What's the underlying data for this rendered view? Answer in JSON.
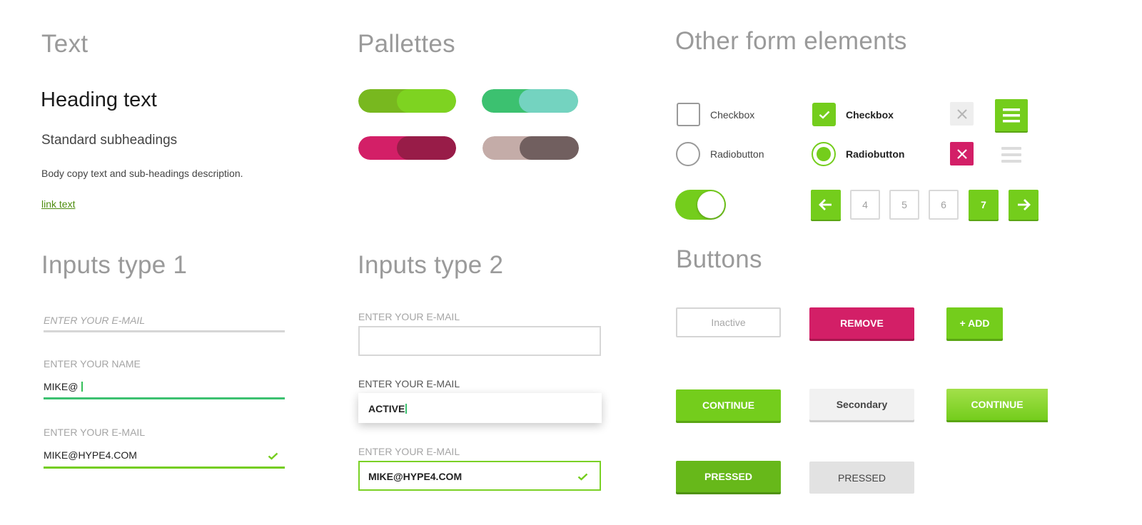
{
  "colors": {
    "green": "#74cd1c",
    "green_light": "#7ed321",
    "green_dark": "#6db81f",
    "teal": "#3cc170",
    "teal_light": "#74d3c0",
    "magenta": "#d31f67",
    "plum": "#981c48",
    "taupe": "#c4aca8",
    "taupe_dark": "#715f5f",
    "title_grey": "#9a9a9a"
  },
  "text_section": {
    "title": "Text",
    "heading": "Heading text",
    "subheading": "Standard subheadings",
    "body": "Body copy text and sub-headings description.",
    "link": "link text"
  },
  "palettes": {
    "title": "Pallettes",
    "swatches": [
      {
        "name": "green",
        "left": "#78b81f",
        "right": "#7ed321"
      },
      {
        "name": "teal",
        "left": "#3cc170",
        "right": "#74d3c0"
      },
      {
        "name": "magenta",
        "left": "#d31f67",
        "right": "#981c48"
      },
      {
        "name": "taupe",
        "left": "#c4aca8",
        "right": "#715f5f"
      }
    ]
  },
  "other_form": {
    "title": "Other form elements",
    "checkbox_label": "Checkbox",
    "checkbox_checked_label": "Checkbox",
    "radio_label": "Radiobutton",
    "radio_checked_label": "Radiobutton",
    "toggle_on": true,
    "pagination": {
      "pages": [
        "4",
        "5",
        "6",
        "7"
      ],
      "current": "7"
    }
  },
  "inputs1": {
    "title": "Inputs type 1",
    "field1": {
      "placeholder": "ENTER YOUR E-MAIL"
    },
    "field2": {
      "label": "ENTER YOUR NAME",
      "value": "MIKE@"
    },
    "field3": {
      "label": "ENTER YOUR E-MAIL",
      "value": "MIKE@HYPE4.COM"
    }
  },
  "inputs2": {
    "title": "Inputs type 2",
    "field1": {
      "label": "ENTER YOUR E-MAIL"
    },
    "field2": {
      "label": "ENTER YOUR E-MAIL",
      "value": "ACTIVE"
    },
    "field3": {
      "label": "ENTER YOUR E-MAIL",
      "value": "MIKE@HYPE4.COM"
    }
  },
  "buttons": {
    "title": "Buttons",
    "inactive": "Inactive",
    "remove": "REMOVE",
    "add": "+ ADD",
    "continue": "CONTINUE",
    "secondary": "Secondary",
    "continue_gradient": "CONTINUE",
    "pressed_primary": "PRESSED",
    "pressed_secondary": "PRESSED"
  }
}
